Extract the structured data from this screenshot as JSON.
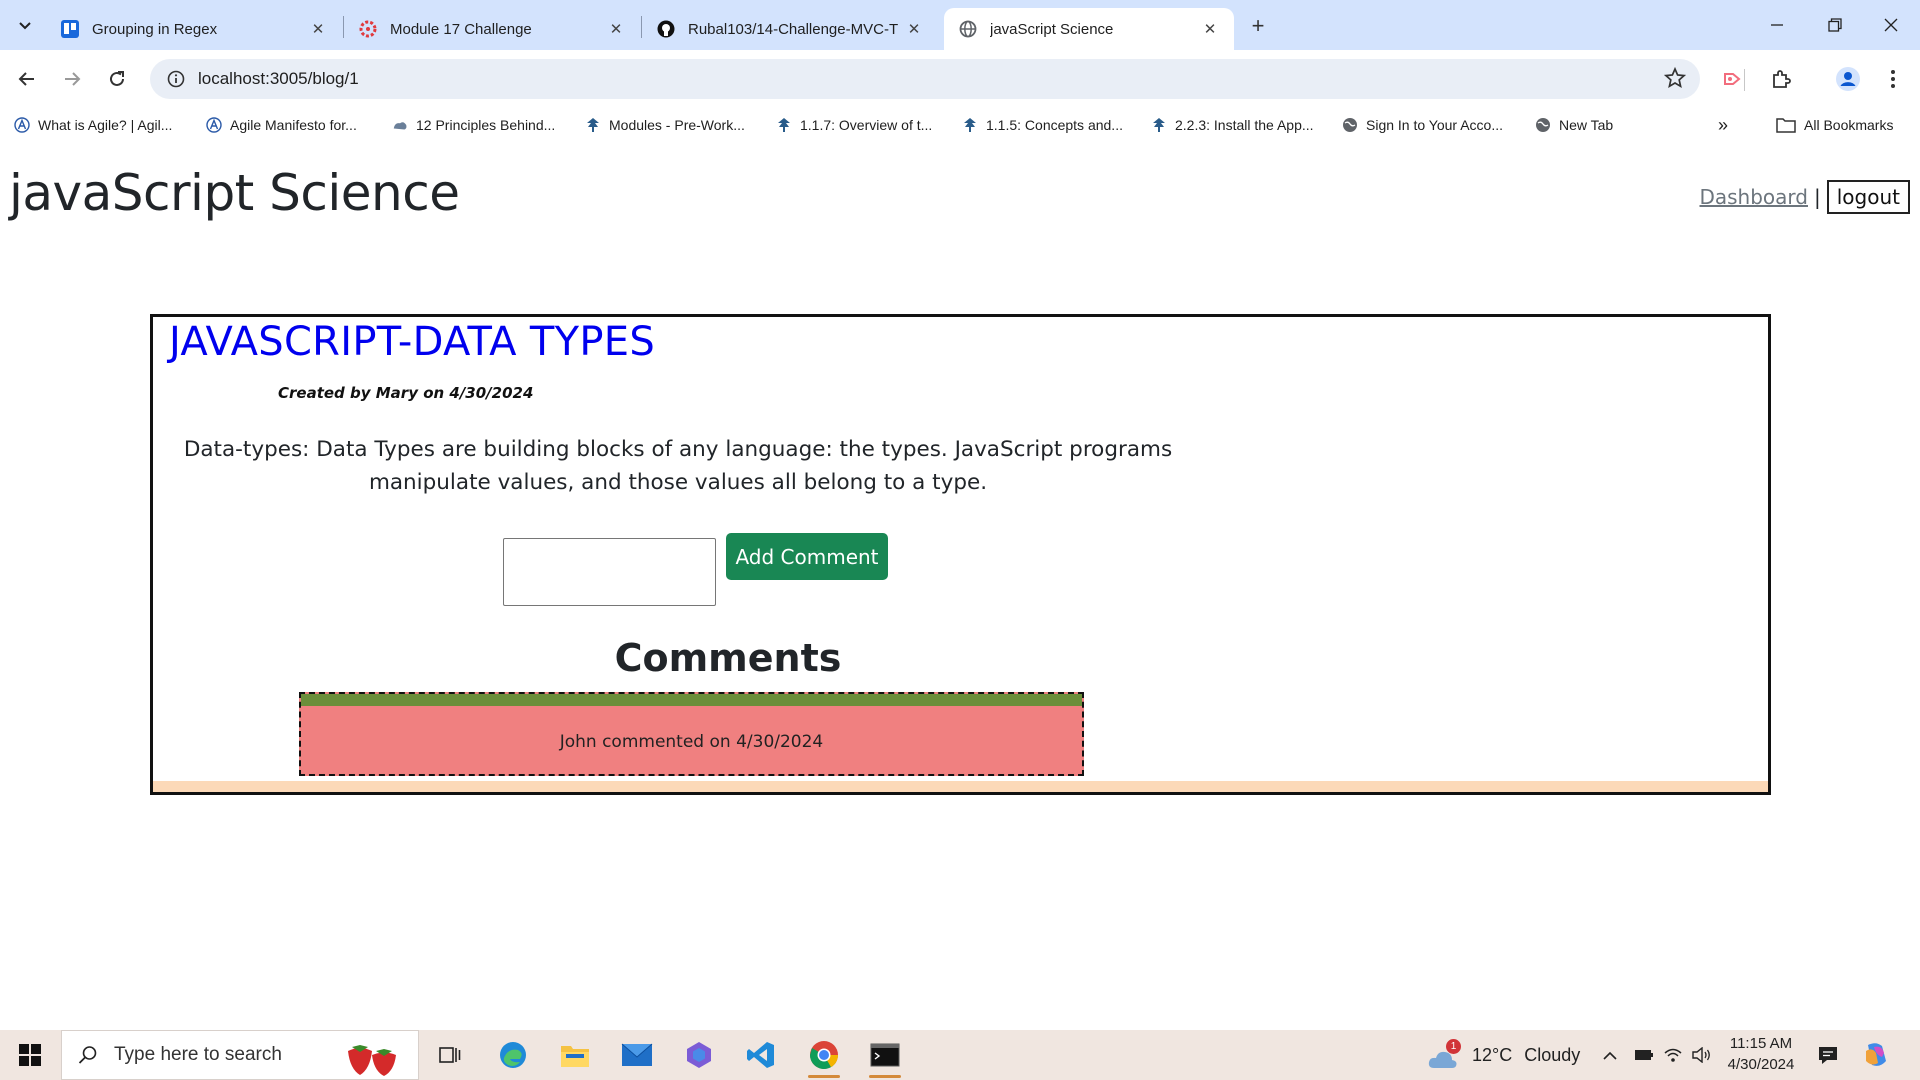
{
  "browser": {
    "tabs": [
      {
        "title": "Grouping in Regex",
        "icon": "trello-icon"
      },
      {
        "title": "Module 17 Challenge",
        "icon": "canvas-icon"
      },
      {
        "title": "Rubal103/14-Challenge-MVC-T",
        "icon": "github-icon"
      },
      {
        "title": "javaScript Science",
        "icon": "globe-icon",
        "active": true
      }
    ],
    "url": "localhost:3005/blog/1",
    "bookmarks": [
      "What is Agile? | Agil...",
      "Agile Manifesto for...",
      "12 Principles Behind...",
      "Modules - Pre-Work...",
      "1.1.7: Overview of t...",
      "1.1.5: Concepts and...",
      "2.2.3: Install the App...",
      "Sign In to Your Acco...",
      "New Tab"
    ],
    "all_bookmarks": "All Bookmarks"
  },
  "site": {
    "title": "javaScript Science",
    "nav": {
      "dashboard": "Dashboard",
      "separator": "|",
      "logout": "logout"
    }
  },
  "post": {
    "title": "JAVASCRIPT-DATA TYPES",
    "meta": "Created by Mary on 4/30/2024",
    "body": "Data-types: Data Types are building blocks of any language: the types. JavaScript programs manipulate values, and those values all belong to a type.",
    "comment_input_value": "",
    "add_comment_label": "Add Comment",
    "comments_heading": "Comments",
    "comments": [
      {
        "text": "John commented on 4/30/2024"
      }
    ]
  },
  "taskbar": {
    "search_placeholder": "Type here to search",
    "weather": {
      "temp": "12°C",
      "condition": "Cloudy",
      "alert_count": "1"
    },
    "time": "11:15 AM",
    "date": "4/30/2024"
  },
  "colors": {
    "tabstrip": "#d3e3fd",
    "post_title": "#0000ee",
    "add_button": "#198754",
    "comment_bg": "#f08080",
    "comment_bar": "#6b8e3a",
    "card_footer": "#fcd9b8",
    "taskbar": "#f0e6e0"
  }
}
